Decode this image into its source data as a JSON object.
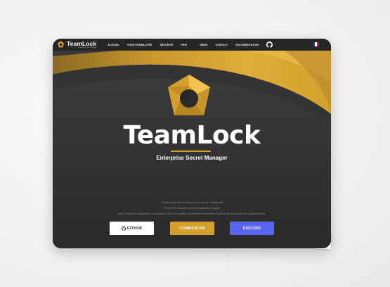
{
  "nav": {
    "brand_name": "TeamLock",
    "brand_sub": "Enterprise Secret Manager",
    "links": [
      "Accueil",
      "Fonctionnalités",
      "Sécurité",
      "Prix",
      "Démo",
      "Contact",
      "Documentation"
    ],
    "github_icon": "github-icon",
    "language_flag": "french-flag-icon"
  },
  "hero": {
    "title": "TeamLock",
    "subtitle": "Enterprise Secret Manager",
    "description": [
      "Gestionnaire de secrets pour le travail collaboratif",
      "Flexible et sécurisé pour les grandes équipes",
      "Avec TeamLock organisez vos secrets dans des coffres de manière sécurisée et gérez les accès de vos collaborateurs."
    ]
  },
  "buttons": {
    "github": "Github",
    "start": "Commencer",
    "discord": "Discord"
  },
  "colors": {
    "accent": "#d4a02b",
    "background": "#2b2b2b",
    "discord": "#5865f2"
  }
}
